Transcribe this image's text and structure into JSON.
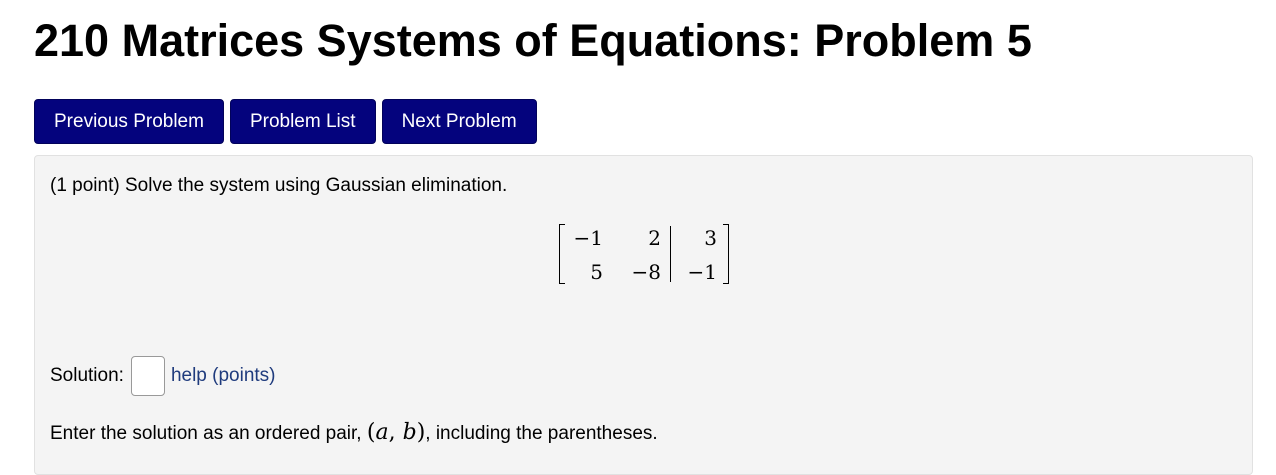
{
  "header": {
    "title": "210 Matrices Systems of Equations: Problem 5"
  },
  "nav": {
    "previous_label": "Previous Problem",
    "list_label": "Problem List",
    "next_label": "Next Problem"
  },
  "problem": {
    "intro": "(1 point) Solve the system using Gaussian elimination.",
    "matrix": {
      "rows": [
        [
          "−1",
          "2",
          "3"
        ],
        [
          "5",
          "−8",
          "−1"
        ]
      ]
    },
    "solution_label": "Solution:",
    "answer_value": "",
    "help_label": "help (points)",
    "instructions_before": "Enter the solution as an ordered pair, ",
    "instructions_math": {
      "open": "(",
      "a": "a",
      "comma": ", ",
      "b": "b",
      "close": ")"
    },
    "instructions_after": ", including the parentheses."
  },
  "colors": {
    "button_bg": "#04037d",
    "panel_bg": "#f4f4f4",
    "link": "#1f3b7d"
  }
}
